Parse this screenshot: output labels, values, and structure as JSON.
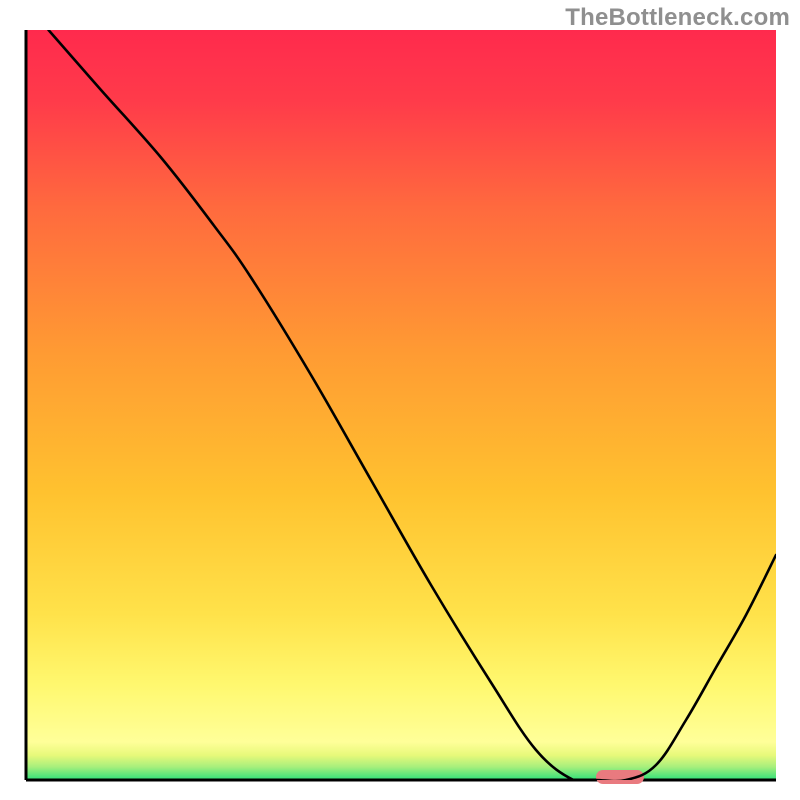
{
  "watermark": "TheBottleneck.com",
  "chart_data": {
    "type": "line",
    "title": "",
    "xlabel": "",
    "ylabel": "",
    "xlim": [
      0,
      100
    ],
    "ylim": [
      0,
      100
    ],
    "grid": false,
    "legend": false,
    "annotations": [],
    "background_gradient": {
      "top_color": "#ff2a4d",
      "mid_color": "#ffd633",
      "lower_band_color": "#ffff99",
      "bottom_color": "#2fe07a"
    },
    "series": [
      {
        "name": "bottleneck-curve",
        "color": "#000000",
        "note": "x is horizontal position (0=left frame edge, 100=right frame edge); y is 0 at bottom frame edge, 100 at top. Values estimated from pixels.",
        "x": [
          3,
          10,
          18,
          25,
          30,
          38,
          46,
          54,
          62,
          68,
          73,
          76,
          80,
          84,
          88,
          92,
          96,
          100
        ],
        "y": [
          100,
          92,
          83,
          74,
          67,
          54,
          40,
          26,
          13,
          4,
          0,
          0,
          0,
          2,
          8,
          15,
          22,
          30
        ]
      }
    ],
    "marker": {
      "name": "optimal-range-bar",
      "color": "#e97a7f",
      "x_start": 76,
      "x_end": 82,
      "y": 0,
      "note": "short rounded bar sitting on the x-axis at the curve minimum"
    },
    "frame": {
      "left": true,
      "bottom": true,
      "right": false,
      "top": false,
      "color": "#000000",
      "width": 3
    }
  }
}
